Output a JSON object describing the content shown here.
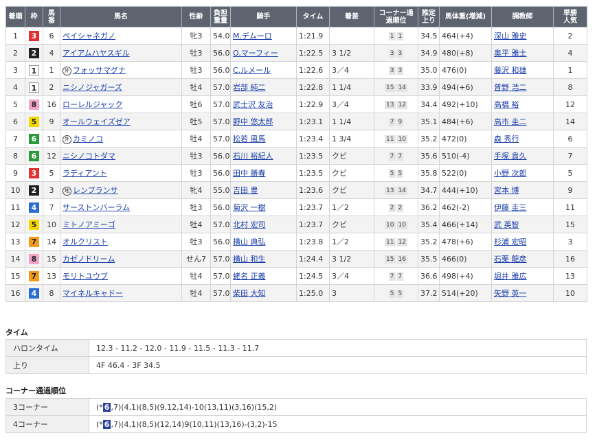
{
  "headers": [
    "着順",
    "枠",
    "馬番",
    "馬名",
    "性齢",
    "負担重量",
    "騎手",
    "タイム",
    "着差",
    "コーナー通過順位",
    "推定上り",
    "馬体重(増減)",
    "調教師",
    "単勝人気"
  ],
  "rows": [
    {
      "pos": "1",
      "waku": "3",
      "num": "6",
      "horse": "ペイシャネガノ",
      "badge": "",
      "sexage": "牝3",
      "weight": "54.0",
      "jockey": "M.デムーロ",
      "time": "1:21.9",
      "margin": "",
      "c1": "1",
      "c2": "1",
      "agari": "34.5",
      "bw": "464(+4)",
      "trainer": "深山 雅史",
      "pop": "2"
    },
    {
      "pos": "2",
      "waku": "2",
      "num": "4",
      "horse": "アイアムハヤスギル",
      "badge": "",
      "sexage": "牡3",
      "weight": "56.0",
      "jockey": "O.マーフィー",
      "time": "1:22.5",
      "margin": "3 1/2",
      "c1": "3",
      "c2": "3",
      "agari": "34.9",
      "bw": "480(+8)",
      "trainer": "奥平 雅士",
      "pop": "4"
    },
    {
      "pos": "3",
      "waku": "1",
      "num": "1",
      "horse": "フォッサマグナ",
      "badge": "外",
      "sexage": "牡3",
      "weight": "56.0",
      "jockey": "C.ルメール",
      "time": "1:22.6",
      "margin": "3／4",
      "c1": "3",
      "c2": "3",
      "agari": "35.0",
      "bw": "476(0)",
      "trainer": "藤沢 和雄",
      "pop": "1"
    },
    {
      "pos": "4",
      "waku": "1",
      "num": "2",
      "horse": "ニシノジャガーズ",
      "badge": "",
      "sexage": "牡4",
      "weight": "57.0",
      "jockey": "岩部 純二",
      "time": "1:22.8",
      "margin": "1 1/4",
      "c1": "15",
      "c2": "14",
      "agari": "33.9",
      "bw": "494(+6)",
      "trainer": "普野 浩二",
      "pop": "8"
    },
    {
      "pos": "5",
      "waku": "8",
      "num": "16",
      "horse": "ローレルジャック",
      "badge": "",
      "sexage": "牡6",
      "weight": "57.0",
      "jockey": "武士沢 友治",
      "time": "1:22.9",
      "margin": "3／4",
      "c1": "13",
      "c2": "12",
      "agari": "34.4",
      "bw": "492(+10)",
      "trainer": "高橋 裕",
      "pop": "12"
    },
    {
      "pos": "6",
      "waku": "5",
      "num": "9",
      "horse": "オールウェイズゼア",
      "badge": "",
      "sexage": "牡5",
      "weight": "57.0",
      "jockey": "野中 悠太郎",
      "time": "1:23.1",
      "margin": "1 1/4",
      "c1": "7",
      "c2": "9",
      "agari": "35.1",
      "bw": "484(+6)",
      "trainer": "高市 圭二",
      "pop": "14"
    },
    {
      "pos": "7",
      "waku": "6",
      "num": "11",
      "horse": "カミノコ",
      "badge": "外",
      "sexage": "牡4",
      "weight": "57.0",
      "jockey": "松若 風馬",
      "time": "1:23.4",
      "margin": "1 3/4",
      "c1": "11",
      "c2": "10",
      "agari": "35.2",
      "bw": "472(0)",
      "trainer": "森 秀行",
      "pop": "6"
    },
    {
      "pos": "8",
      "waku": "6",
      "num": "12",
      "horse": "ニシノコトダマ",
      "badge": "",
      "sexage": "牡3",
      "weight": "56.0",
      "jockey": "石川 裕紀人",
      "time": "1:23.5",
      "margin": "クビ",
      "c1": "7",
      "c2": "7",
      "agari": "35.6",
      "bw": "510(-4)",
      "trainer": "手塚 貴久",
      "pop": "7"
    },
    {
      "pos": "9",
      "waku": "3",
      "num": "5",
      "horse": "ラディアント",
      "badge": "",
      "sexage": "牡3",
      "weight": "56.0",
      "jockey": "田中 勝春",
      "time": "1:23.5",
      "margin": "クビ",
      "c1": "5",
      "c2": "5",
      "agari": "35.8",
      "bw": "522(0)",
      "trainer": "小野 次郎",
      "pop": "5"
    },
    {
      "pos": "10",
      "waku": "2",
      "num": "3",
      "horse": "レンブランサ",
      "badge": "地",
      "sexage": "牝4",
      "weight": "55.0",
      "jockey": "吉田 豊",
      "time": "1:23.6",
      "margin": "クビ",
      "c1": "13",
      "c2": "14",
      "agari": "34.7",
      "bw": "444(+10)",
      "trainer": "宮本 博",
      "pop": "9"
    },
    {
      "pos": "11",
      "waku": "4",
      "num": "7",
      "horse": "サーストンバーラム",
      "badge": "",
      "sexage": "牡3",
      "weight": "56.0",
      "jockey": "菊沢 一樹",
      "time": "1:23.7",
      "margin": "1／2",
      "c1": "2",
      "c2": "2",
      "agari": "36.2",
      "bw": "462(-2)",
      "trainer": "伊藤 圭三",
      "pop": "11"
    },
    {
      "pos": "12",
      "waku": "5",
      "num": "10",
      "horse": "ミトノアミーゴ",
      "badge": "",
      "sexage": "牡4",
      "weight": "57.0",
      "jockey": "北村 宏司",
      "time": "1:23.7",
      "margin": "クビ",
      "c1": "10",
      "c2": "10",
      "agari": "35.4",
      "bw": "466(+14)",
      "trainer": "武 英智",
      "pop": "15"
    },
    {
      "pos": "13",
      "waku": "7",
      "num": "14",
      "horse": "オルクリスト",
      "badge": "",
      "sexage": "牡3",
      "weight": "56.0",
      "jockey": "横山 典弘",
      "time": "1:23.8",
      "margin": "1／2",
      "c1": "11",
      "c2": "12",
      "agari": "35.2",
      "bw": "478(+6)",
      "trainer": "杉浦 宏昭",
      "pop": "3"
    },
    {
      "pos": "14",
      "waku": "8",
      "num": "15",
      "horse": "カゼノドリーム",
      "badge": "",
      "sexage": "せん7",
      "weight": "57.0",
      "jockey": "横山 和生",
      "time": "1:24.4",
      "margin": "3 1/2",
      "c1": "15",
      "c2": "16",
      "agari": "35.5",
      "bw": "466(0)",
      "trainer": "石栗 龍彦",
      "pop": "16"
    },
    {
      "pos": "15",
      "waku": "7",
      "num": "13",
      "horse": "モリトユウブ",
      "badge": "",
      "sexage": "牡4",
      "weight": "57.0",
      "jockey": "蛯名 正義",
      "time": "1:24.5",
      "margin": "3／4",
      "c1": "7",
      "c2": "7",
      "agari": "36.6",
      "bw": "498(+4)",
      "trainer": "堀井 雅広",
      "pop": "13"
    },
    {
      "pos": "16",
      "waku": "4",
      "num": "8",
      "horse": "マイネルキャドー",
      "badge": "",
      "sexage": "牡4",
      "weight": "57.0",
      "jockey": "柴田 大知",
      "time": "1:25.0",
      "margin": "3",
      "c1": "5",
      "c2": "5",
      "agari": "37.2",
      "bw": "514(+20)",
      "trainer": "矢野 英一",
      "pop": "10"
    }
  ],
  "time_section": {
    "title": "タイム",
    "furlong_label": "ハロンタイム",
    "furlong_value": "12.3 - 11.2 - 12.0 - 11.9 - 11.5 - 11.3 - 11.7",
    "agari_label": "上り",
    "agari_value": "4F 46.4 - 3F 34.5"
  },
  "corner_section": {
    "title": "コーナー通過順位",
    "c3_label": "3コーナー",
    "c3_pre": "(*",
    "c3_hl": "6",
    "c3_post": ",7)(4,1)(8,5)(9,12,14)-10(13,11)(3,16)(15,2)",
    "c4_label": "4コーナー",
    "c4_pre": "(*",
    "c4_hl": "6",
    "c4_post": ",7)(4,1)(8,5)(12,14)9(10,11)(13,16)-(3,2)-15"
  }
}
